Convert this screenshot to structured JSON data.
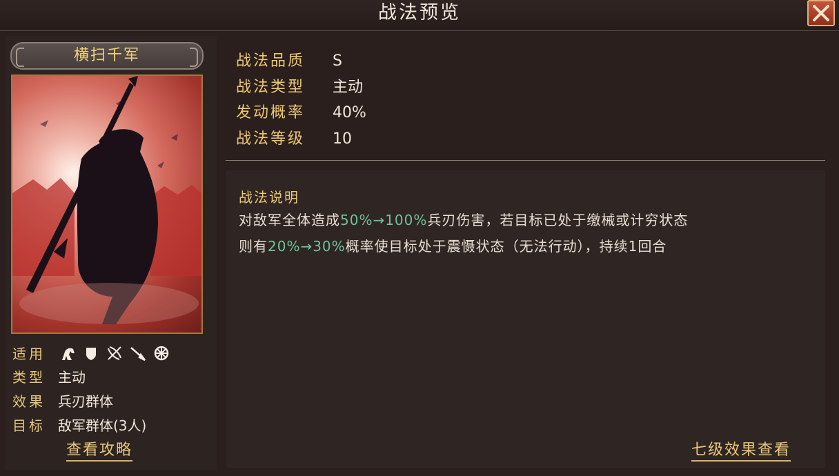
{
  "header": {
    "title": "战法预览"
  },
  "skill": {
    "name": "横扫千军"
  },
  "left": {
    "attrs": [
      {
        "key": "适用",
        "value": ""
      },
      {
        "key": "类型",
        "value": "主动"
      },
      {
        "key": "效果",
        "value": "兵刃群体"
      },
      {
        "key": "目标",
        "value": "敌军群体(3人)"
      }
    ],
    "troop_icons": [
      "cavalry-icon",
      "shield-icon",
      "bow-icon",
      "spear-icon",
      "siege-icon"
    ],
    "guide_link": "查看攻略"
  },
  "info": [
    {
      "key": "战法品质",
      "value": "S"
    },
    {
      "key": "战法类型",
      "value": "主动"
    },
    {
      "key": "发动概率",
      "value": "40%"
    },
    {
      "key": "战法等级",
      "value": "10"
    }
  ],
  "description": {
    "title": "战法说明",
    "line1": {
      "a": "对敌军全体造成",
      "b": "50%→100%",
      "c": "兵刃伤害，若目标已处于缴械或计穷状态"
    },
    "line2": {
      "a": "则有",
      "b": "20%→30%",
      "c": "概率使目标处于震慑状态（无法行动），持续1回合"
    }
  },
  "level7_link": "七级效果查看",
  "colors": {
    "gold": "#ecc874",
    "highlight": "#6fc39a",
    "close_red": "#b8442f"
  }
}
